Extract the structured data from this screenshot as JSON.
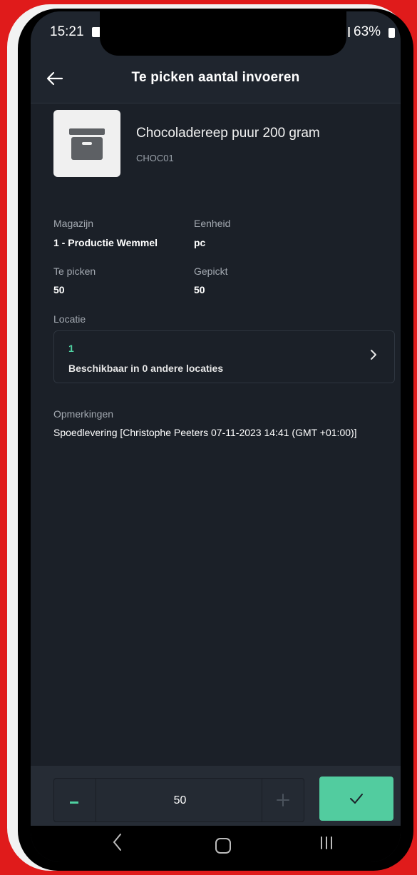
{
  "status_bar": {
    "time": "15:21",
    "battery": "63%"
  },
  "app_bar": {
    "back_icon": "arrow-left-icon",
    "title": "Te picken aantal invoeren"
  },
  "product": {
    "icon": "archive-box-icon",
    "name": "Chocoladereep puur 200 gram",
    "code": "CHOC01"
  },
  "details": {
    "warehouse_label": "Magazijn",
    "warehouse_value": "1 - Productie Wemmel",
    "unit_label": "Eenheid",
    "unit_value": "pc",
    "to_pick_label": "Te picken",
    "to_pick_value": "50",
    "picked_label": "Gepickt",
    "picked_value": "50"
  },
  "location": {
    "label": "Locatie",
    "number": "1",
    "availability": "Beschikbaar in 0 andere locaties"
  },
  "remarks": {
    "label": "Opmerkingen",
    "text": "Spoedlevering [Christophe Peeters 07-11-2023 14:41 (GMT +01:00)]"
  },
  "footer": {
    "quantity": "50",
    "minus_icon": "minus-icon",
    "plus_icon": "plus-icon",
    "confirm_icon": "check-icon"
  },
  "colors": {
    "accent": "#52cc9f",
    "background": "#1b2028",
    "frame": "#e01b1b"
  }
}
